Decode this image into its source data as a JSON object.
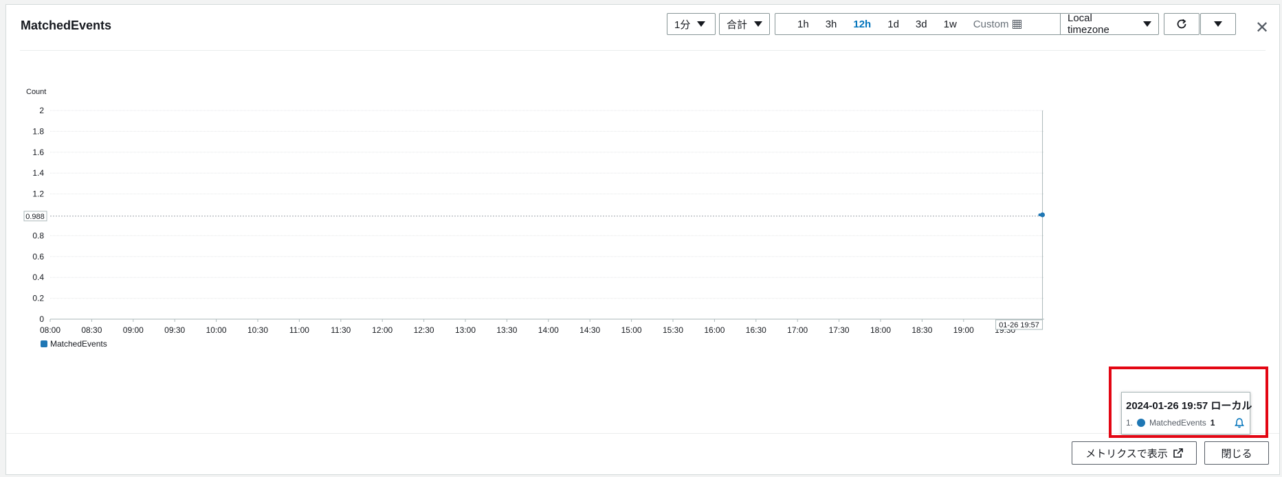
{
  "title": "MatchedEvents",
  "controls": {
    "period": "1分",
    "stat": "合計",
    "ranges": [
      "1h",
      "3h",
      "12h",
      "1d",
      "3d",
      "1w"
    ],
    "active_range": "12h",
    "custom": "Custom",
    "timezone": "Local timezone"
  },
  "chart_data": {
    "type": "line",
    "ylabel": "Count",
    "ylim": [
      0,
      2
    ],
    "yticks": [
      "0",
      "0.2",
      "0.4",
      "0.6",
      "0.8",
      "0.988",
      "1.2",
      "1.4",
      "1.6",
      "1.8",
      "2"
    ],
    "xticks": [
      "08:00",
      "08:30",
      "09:00",
      "09:30",
      "10:00",
      "10:30",
      "11:00",
      "11:30",
      "12:00",
      "12:30",
      "13:00",
      "13:30",
      "14:00",
      "14:30",
      "15:00",
      "15:30",
      "16:00",
      "16:30",
      "17:00",
      "17:30",
      "18:00",
      "18:30",
      "19:00",
      "19:30"
    ],
    "cursor_x_label": "01-26 19:57",
    "series": [
      {
        "name": "MatchedEvents",
        "color": "#1f77b4",
        "points": [
          [
            "19:55",
            1
          ],
          [
            "19:57",
            1
          ]
        ]
      }
    ],
    "legend": "bottom-left"
  },
  "tooltip": {
    "title": "2024-01-26 19:57 ローカル",
    "index": "1.",
    "series": "MatchedEvents",
    "value": "1"
  },
  "footer": {
    "view_metrics": "メトリクスで表示",
    "close": "閉じる"
  }
}
